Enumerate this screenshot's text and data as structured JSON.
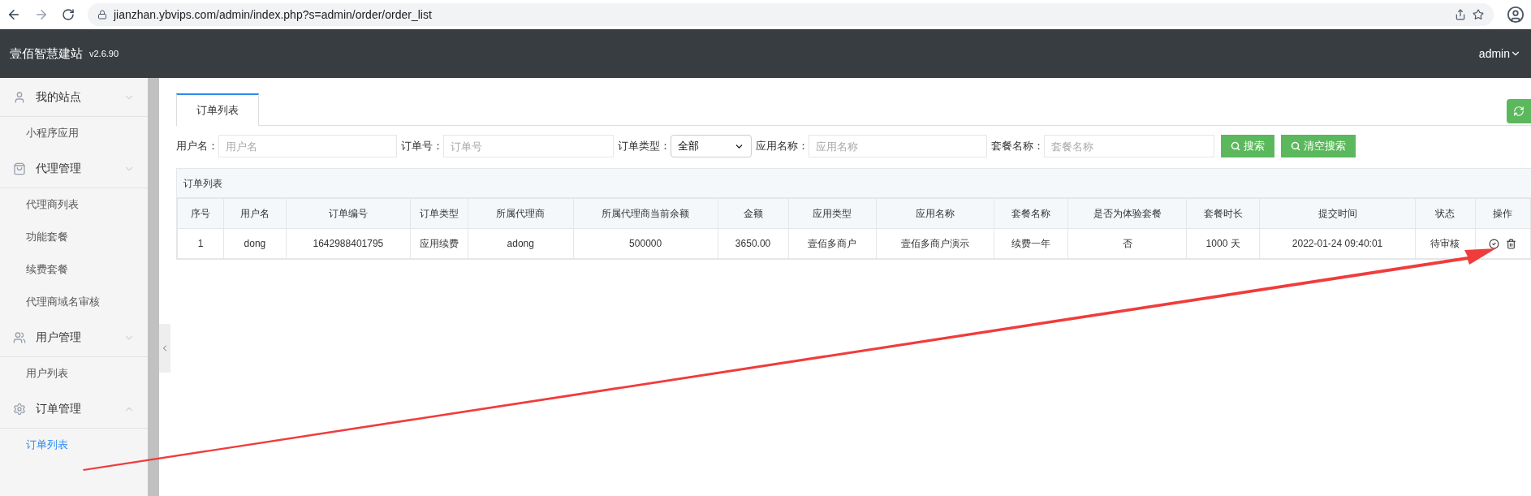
{
  "browser": {
    "url": "jianzhan.ybvips.com/admin/index.php?s=admin/order/order_list"
  },
  "header": {
    "brand": "壹佰智慧建站",
    "version": "v2.6.90",
    "user": "admin"
  },
  "sidebar": {
    "groups": [
      {
        "label": "我的站点",
        "expanded": false,
        "items": [
          {
            "label": "小程序应用",
            "selected": false
          }
        ]
      },
      {
        "label": "代理管理",
        "expanded": false,
        "items": [
          {
            "label": "代理商列表",
            "selected": false
          },
          {
            "label": "功能套餐",
            "selected": false
          },
          {
            "label": "续费套餐",
            "selected": false
          },
          {
            "label": "代理商域名审核",
            "selected": false
          }
        ]
      },
      {
        "label": "用户管理",
        "expanded": false,
        "items": [
          {
            "label": "用户列表",
            "selected": false
          }
        ]
      },
      {
        "label": "订单管理",
        "expanded": true,
        "items": [
          {
            "label": "订单列表",
            "selected": true
          }
        ]
      }
    ]
  },
  "tabs": [
    {
      "label": "订单列表",
      "selected": true
    }
  ],
  "filters": [
    {
      "kind": "input",
      "label": "用户名：",
      "placeholder": "用户名"
    },
    {
      "kind": "input",
      "label": "订单号：",
      "placeholder": "订单号"
    },
    {
      "kind": "select",
      "label": "订单类型：",
      "value": "全部"
    },
    {
      "kind": "input",
      "label": "应用名称：",
      "placeholder": "应用名称"
    },
    {
      "kind": "input",
      "label": "套餐名称：",
      "placeholder": "套餐名称"
    }
  ],
  "buttons": [
    "搜索",
    "清空搜索"
  ],
  "table": {
    "title": "订单列表",
    "columns": [
      "序号",
      "用户名",
      "订单编号",
      "订单类型",
      "所属代理商",
      "所属代理商当前余额",
      "金额",
      "应用类型",
      "应用名称",
      "套餐名称",
      "是否为体验套餐",
      "套餐时长",
      "提交时间",
      "状态",
      "操作"
    ],
    "rows": [
      {
        "cells": [
          "1",
          "dong",
          "1642988401795",
          "应用续费",
          "adong",
          "500000",
          "3650.00",
          "壹佰多商户",
          "壹佰多商户演示",
          "续费一年",
          "否",
          "1000 天",
          "2022-01-24 09:40:01",
          "待审核"
        ]
      }
    ]
  }
}
